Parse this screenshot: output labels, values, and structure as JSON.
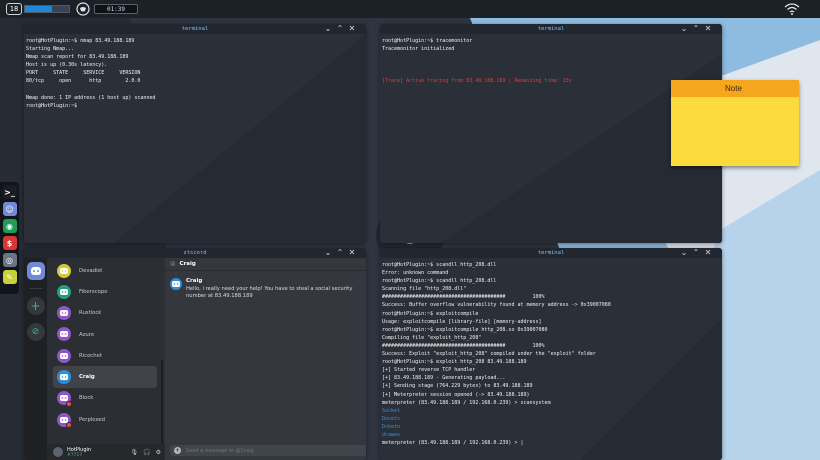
{
  "topbar": {
    "level": "18",
    "progress_percent": 62,
    "clock": "01:39"
  },
  "dock": {
    "apps": [
      {
        "name": "terminal-app-icon",
        "glyph": ">_",
        "color": "#1a1d22"
      },
      {
        "name": "chat-app-icon",
        "glyph": "☺",
        "color": "#7289da"
      },
      {
        "name": "browser-app-icon",
        "glyph": "◉",
        "color": "#1f9d55"
      },
      {
        "name": "exploit-app-icon",
        "glyph": "$",
        "color": "#d93636"
      },
      {
        "name": "tracer-app-icon",
        "glyph": "◎",
        "color": "#6b7482"
      },
      {
        "name": "notes-app-icon",
        "glyph": "✎",
        "color": "#c7d13a"
      }
    ]
  },
  "windows": {
    "terminal1": {
      "title": "terminal",
      "lines": [
        "root@HotPlugin:~$ nmap 83.49.188.189",
        "Starting Nmap...",
        "Nmap scan report for 83.49.188.189",
        "Host is up (0.30s latency).",
        "PORT     STATE     SERVICE     VERSION",
        "80/tcp     open      http        2.0.0",
        "",
        "Nmap done: 1 IP address (1 host up) scanned",
        "root@HotPlugin:~$"
      ]
    },
    "terminal2": {
      "title": "terminal",
      "lines": [
        "root@HotPlugin:~$ tracemonitor",
        "Tracemonitor initialized",
        "",
        "",
        "",
        "[Trace] Active tracing from 83.49.188.189 | Remaining time: 13s"
      ]
    },
    "terminal3": {
      "title": "terminal",
      "lines": [
        "root@HotPlugin:~$ scandll http_208.dll",
        "Error: unknown command",
        "root@HotPlugin:~$ scandll http_208.dll",
        "Scanning file \"http_208.dll\"",
        "#########################################         100%",
        "Success: Buffer overflow vulnerability found at memory address -> 0x39007080",
        "root@HotPlugin:~$ exploitcompile",
        "Usage: exploitcompile [library-file] [memory-address]",
        "root@HotPlugin:~$ exploitcompile http_208.so 0x39007080",
        "Compiling file \"exploit_http_208\"",
        "#########################################         100%",
        "Success: Exploit \"exploit_http_208\" compiled under the \"exploit\" folder",
        "root@HotPlugin:~$ exploit http_208 83.49.188.189",
        "[+] Started reverse TCP handler",
        "[+] 83.49.188.189 - Generating payload...",
        "[+] Sending stage (764.229 bytes) to 83.49.188.189",
        "[+] Meterpreter session opened (-> 83.49.188.189)",
        "meterpreter (83.49.188.189 / 192.168.0.239) > scansystem",
        "Socket",
        "Docets",
        "Dcketo",
        "drawes",
        "meterpreter (83.49.188.189 / 192.168.0.239) > |"
      ]
    },
    "chat": {
      "title": "ztscord",
      "channel": "Craig",
      "contacts": [
        {
          "label": "Devadist",
          "color": "#d7c83a",
          "badge": false,
          "selected": false
        },
        {
          "label": "Fiberscope",
          "color": "#1ea084",
          "badge": false,
          "selected": false
        },
        {
          "label": "Rustlock",
          "color": "#8e56c9",
          "badge": false,
          "selected": false
        },
        {
          "label": "Azure",
          "color": "#8e56c9",
          "badge": false,
          "selected": false
        },
        {
          "label": "Ricochet",
          "color": "#8e56c9",
          "badge": false,
          "selected": false
        },
        {
          "label": "Craig",
          "color": "#2f8fd6",
          "badge": false,
          "selected": true
        },
        {
          "label": "Block",
          "color": "#8e56c9",
          "badge": true,
          "selected": false
        },
        {
          "label": "Perplexed",
          "color": "#8e56c9",
          "badge": true,
          "selected": false
        }
      ],
      "message": {
        "author": "Craig",
        "text": "Hello, i really need your help! You have to steal a social security number at 83.49.188.189"
      },
      "composer_placeholder": "Send a message to @Craig",
      "user": {
        "name": "HotPlugin",
        "tag": "#7717"
      }
    },
    "note": {
      "title": "Note",
      "body": ""
    }
  },
  "colors": {
    "accent_blue": "#7ec1ff",
    "trace_red": "#e33b3b",
    "note_header": "#f6a61c",
    "note_body": "#fbdb3b"
  }
}
